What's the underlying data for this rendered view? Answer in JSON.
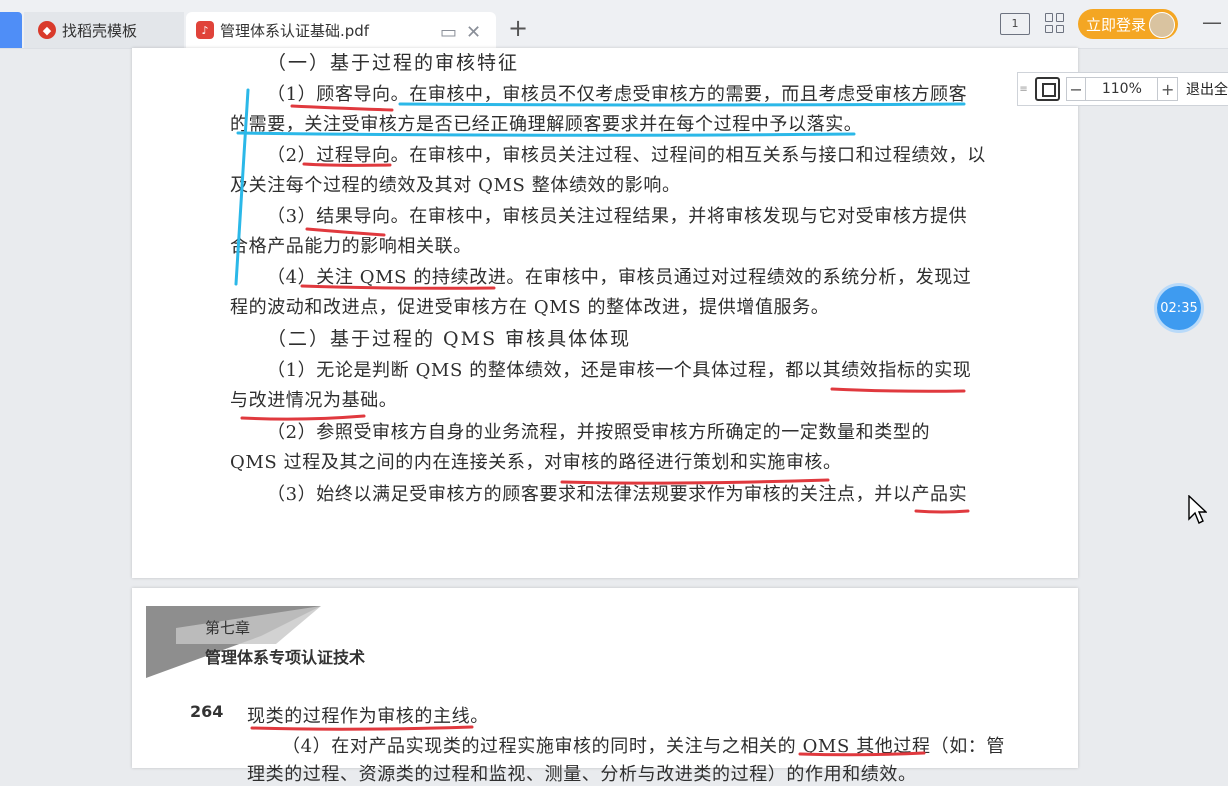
{
  "tabs": {
    "tab1_label": "找稻壳模板",
    "tab1_icon": "docer-logo-icon",
    "tab2_label": "管理体系认证基础.pdf",
    "tab2_icon": "pdf-file-icon",
    "add_label": "+"
  },
  "titlebar": {
    "login_label": "立即登录",
    "read_mode_label": "1",
    "min_label": "—"
  },
  "zoom": {
    "value": "110%",
    "minus": "−",
    "plus": "+",
    "exit_label": "退出全"
  },
  "timer": "02:35",
  "page1_lines": [
    "（一）基于过程的审核特征",
    "（1）顾客导向。在审核中，审核员不仅考虑受审核方的需要，而且考虑受审核方顾客",
    "的需要，关注受审核方是否已经正确理解顾客要求并在每个过程中予以落实。",
    "（2）过程导向。在审核中，审核员关注过程、过程间的相互关系与接口和过程绩效，以",
    "及关注每个过程的绩效及其对 QMS 整体绩效的影响。",
    "（3）结果导向。在审核中，审核员关注过程结果，并将审核发现与它对受审核方提供",
    "合格产品能力的影响相关联。",
    "（4）关注 QMS 的持续改进。在审核中，审核员通过对过程绩效的系统分析，发现过",
    "程的波动和改进点，促进受审核方在 QMS 的整体改进，提供增值服务。",
    "（二）基于过程的 QMS 审核具体体现",
    "（1）无论是判断 QMS 的整体绩效，还是审核一个具体过程，都以其绩效指标的实现",
    "与改进情况为基础。",
    "（2）参照受审核方自身的业务流程，并按照受审核方所确定的一定数量和类型的",
    "QMS 过程及其之间的内在连接关系，对审核的路径进行策划和实施审核。",
    "（3）始终以满足受审核方的顾客要求和法律法规要求作为审核的关注点，并以产品实"
  ],
  "page2": {
    "chapter": "第七章",
    "chapter_title": "管理体系专项认证技术",
    "page_number": "264",
    "line1": "现类的过程作为审核的主线。",
    "line2": "（4）在对产品实现类的过程实施审核的同时，关注与之相关的 QMS 其他过程（如：管",
    "line3": "理类的过程、资源类的过程和监视、测量、分析与改进类的过程）的作用和绩效。"
  },
  "colors": {
    "accent_blue": "#4f8ef7",
    "login_orange": "#f4a623",
    "annotation_red": "#e0393e",
    "annotation_blue": "#2bb8e8",
    "timer_blue": "#3e9bf0"
  }
}
